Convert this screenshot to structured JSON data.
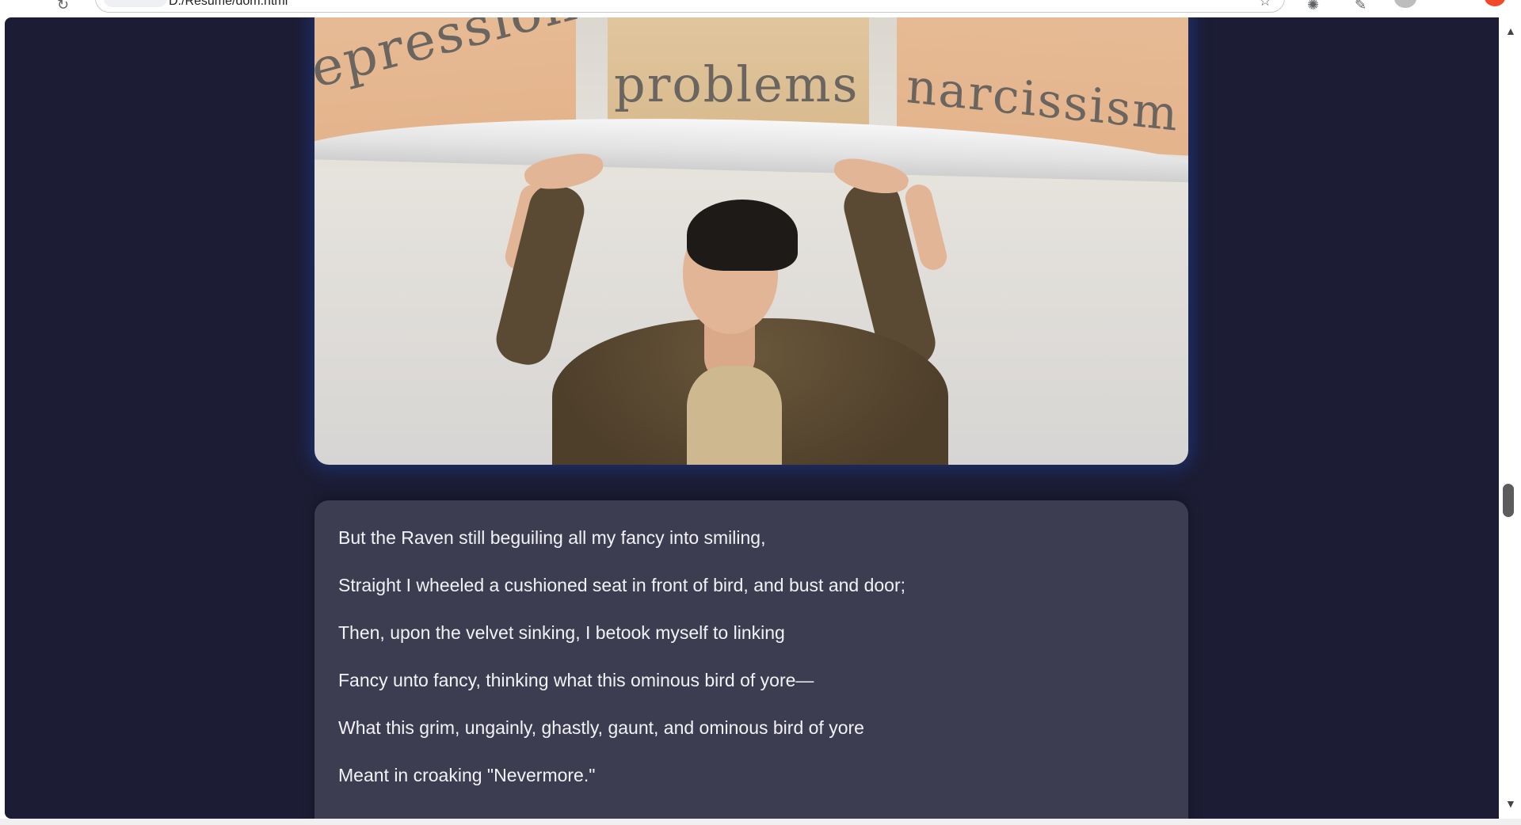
{
  "browser": {
    "url": "D:/Resume/dom.html",
    "reload_icon": "reload-icon",
    "bookmark_icon": "star-icon",
    "extensions_icon": "puzzle-icon",
    "edit_icon": "pencil-icon"
  },
  "hero_image": {
    "alt": "Man lifting a shelf holding boxes labeled depression, problems, narcissism",
    "labels": [
      "epression",
      "problems",
      "narcissism"
    ]
  },
  "poem": {
    "lines": [
      "But the Raven still beguiling all my fancy into smiling,",
      "Straight I wheeled a cushioned seat in front of bird, and bust and door;",
      "Then, upon the velvet sinking, I betook myself to linking",
      "Fancy unto fancy, thinking what this ominous bird of yore—",
      "What this grim, ungainly, ghastly, gaunt, and ominous bird of yore",
      "Meant in croaking \"Nevermore.\""
    ]
  },
  "colors": {
    "page_background": "#1c1c34",
    "card_background": "#3d3d52",
    "text": "#f2f2f6",
    "hero_glow": "#1e46aa"
  },
  "scroll": {
    "position_fraction": 0.57
  }
}
